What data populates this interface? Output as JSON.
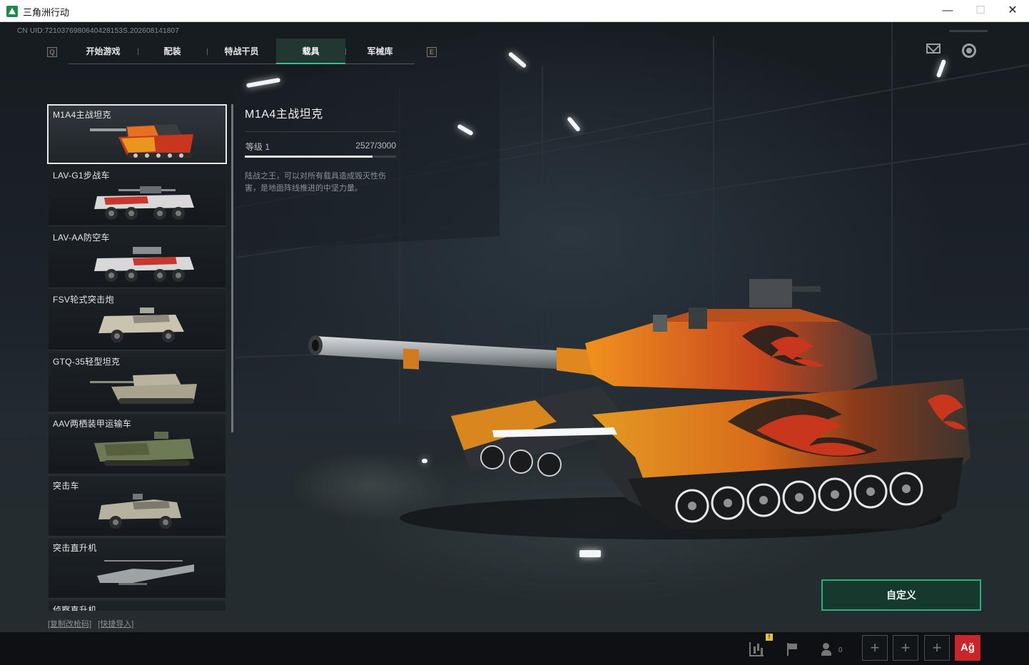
{
  "window": {
    "title": "三角洲行动",
    "minimize": "—",
    "maximize": "☐",
    "close": "✕"
  },
  "uid_text": "CN UID:7210376980640428153S.202608141807",
  "nav": {
    "left_key": "Q",
    "right_key": "E",
    "tabs": [
      {
        "label": "开始游戏",
        "active": false
      },
      {
        "label": "配装",
        "active": false
      },
      {
        "label": "特战干员",
        "active": false
      },
      {
        "label": "载具",
        "active": true
      },
      {
        "label": "军械库",
        "active": false
      }
    ]
  },
  "icons": {
    "mail": "mail-icon",
    "settings": "settings-icon",
    "stats": "stats-icon",
    "flag": "flag-icon",
    "friends": "friends-icon"
  },
  "vehicles": [
    {
      "name": "M1A4主战坦克",
      "selected": true
    },
    {
      "name": "LAV-G1步战车",
      "selected": false
    },
    {
      "name": "LAV-AA防空车",
      "selected": false
    },
    {
      "name": "FSV轮式突击炮",
      "selected": false
    },
    {
      "name": "GTQ-35轻型坦克",
      "selected": false
    },
    {
      "name": "AAV两栖装甲运输车",
      "selected": false
    },
    {
      "name": "突击车",
      "selected": false
    },
    {
      "name": "突击直升机",
      "selected": false
    },
    {
      "name": "侦察直升机",
      "selected": false
    }
  ],
  "bottom_links": {
    "copy": "[复制改枪码]",
    "import": "[快捷导入]"
  },
  "detail": {
    "title": "M1A4主战坦克",
    "level_label": "等级 1",
    "xp_text": "2527/3000",
    "xp_progress": 0.842,
    "description": "陆战之王，可以对所有载具造成毁灭性伤害，是地面阵线推进的中坚力量。"
  },
  "customize_label": "自定义",
  "bottombar": {
    "stats_badge": "!",
    "friends_count": "0",
    "slot_label": "+",
    "avatar_label": "Ağ"
  },
  "colors": {
    "accent": "#2cc58a",
    "customize_border": "#27b07a",
    "tank_orange": "#e8701e",
    "tank_red": "#c8361e",
    "avatar_red": "#c8262a"
  }
}
